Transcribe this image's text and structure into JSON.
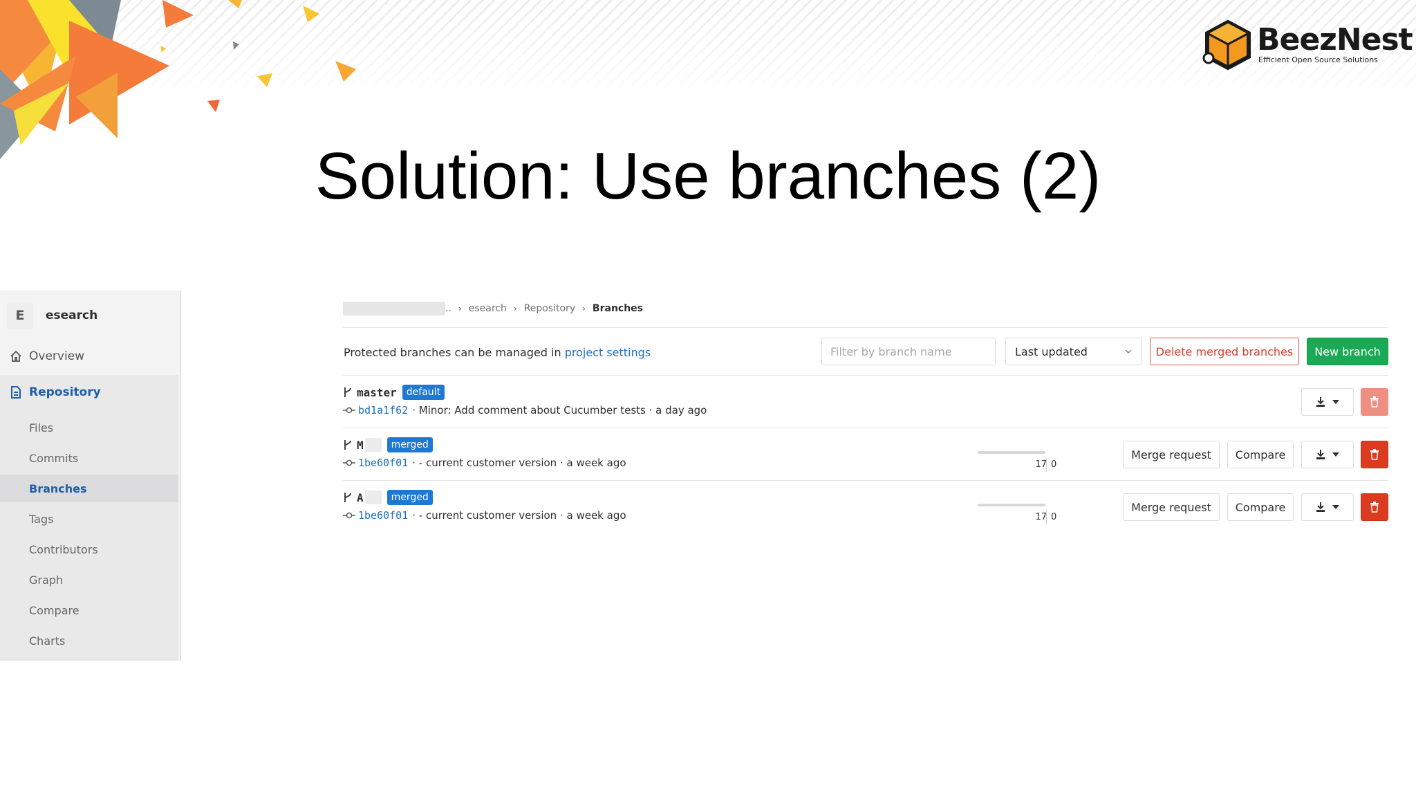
{
  "slide": {
    "title": "Solution: Use branches (2)",
    "logo": {
      "name": "BeezNest",
      "tagline": "Efficient Open Source Solutions"
    },
    "colors": {
      "orange": "#f47b3a",
      "yellow": "#f9e12c",
      "gray": "#7b8a93"
    }
  },
  "sidebar": {
    "project_initial": "E",
    "project_name": "esearch",
    "overview": "Overview",
    "repository": "Repository",
    "sub_items": [
      "Files",
      "Commits",
      "Branches",
      "Tags",
      "Contributors",
      "Graph",
      "Compare",
      "Charts"
    ],
    "active_sub_item": "Branches"
  },
  "breadcrumb": {
    "ellipsis": "..",
    "project": "esearch",
    "section": "Repository",
    "current": "Branches"
  },
  "toolbar": {
    "protected_text": "Protected branches can be managed in ",
    "protected_link": "project settings",
    "filter_placeholder": "Filter by branch name",
    "sort_value": "Last updated",
    "delete_merged_label": "Delete merged branches",
    "new_branch_label": "New branch"
  },
  "branches": [
    {
      "name": "master",
      "badge": "default",
      "sha": "bd1a1f62",
      "message": "· Minor: Add comment about Cucumber tests · a day ago",
      "behind": null,
      "ahead": null,
      "merge_request_label": null,
      "compare_label": null,
      "delete_disabled": true
    },
    {
      "name": "M",
      "badge": "merged",
      "sha": "1be60f01",
      "message": "· - current customer version · a week ago",
      "behind": "17",
      "ahead": "0",
      "merge_request_label": "Merge request",
      "compare_label": "Compare",
      "delete_disabled": false
    },
    {
      "name": "A",
      "badge": "merged",
      "sha": "1be60f01",
      "message": "· - current customer version · a week ago",
      "behind": "17",
      "ahead": "0",
      "merge_request_label": "Merge request",
      "compare_label": "Compare",
      "delete_disabled": false
    }
  ]
}
